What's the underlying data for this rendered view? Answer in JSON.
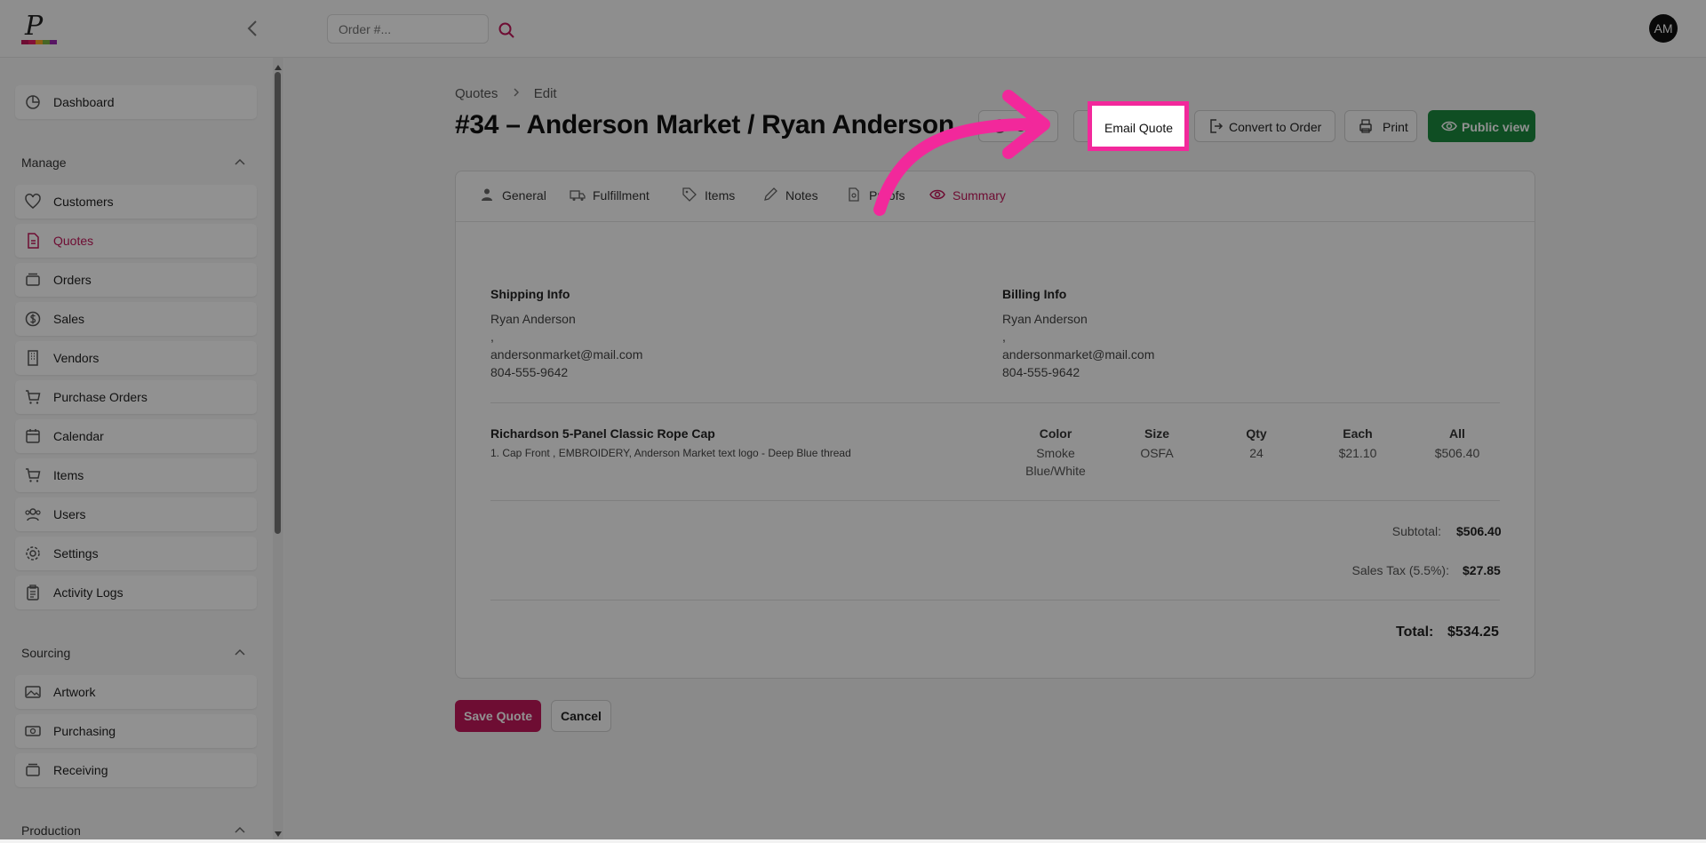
{
  "header": {
    "search": {
      "placeholder": "Order #...",
      "value": ""
    },
    "search_icon": "search-icon",
    "collapse_icon": "chevron-left-icon",
    "avatar_initials": "AM"
  },
  "sidebar": {
    "top_item": {
      "label": "Dashboard",
      "icon": "chart-pie-icon"
    },
    "sections": [
      {
        "title": "Manage",
        "items": [
          {
            "label": "Customers",
            "icon": "heart-icon"
          },
          {
            "label": "Quotes",
            "icon": "document-icon",
            "active": true
          },
          {
            "label": "Orders",
            "icon": "stack-icon"
          },
          {
            "label": "Sales",
            "icon": "dollar-icon"
          },
          {
            "label": "Vendors",
            "icon": "building-icon"
          },
          {
            "label": "Purchase Orders",
            "icon": "cart-icon"
          },
          {
            "label": "Calendar",
            "icon": "calendar-icon"
          },
          {
            "label": "Items",
            "icon": "cart-icon"
          },
          {
            "label": "Users",
            "icon": "users-icon"
          },
          {
            "label": "Settings",
            "icon": "gear-icon"
          },
          {
            "label": "Activity Logs",
            "icon": "clipboard-icon"
          }
        ]
      },
      {
        "title": "Sourcing",
        "items": [
          {
            "label": "Artwork",
            "icon": "image-icon"
          },
          {
            "label": "Purchasing",
            "icon": "money-icon"
          },
          {
            "label": "Receiving",
            "icon": "stack-icon"
          }
        ]
      },
      {
        "title": "Production",
        "items": []
      }
    ]
  },
  "breadcrumb": {
    "parent": "Quotes",
    "current": "Edit"
  },
  "page_title": "#34 – Anderson Market / Ryan Anderson",
  "actions": {
    "save_label": "Save",
    "email_label": "Email Quote",
    "convert_label": "Convert to Order",
    "print_label": "Print",
    "public_label": "Public view"
  },
  "tabs": [
    {
      "label": "General",
      "icon": "user-icon"
    },
    {
      "label": "Fulfillment",
      "icon": "truck-icon"
    },
    {
      "label": "Items",
      "icon": "tag-icon"
    },
    {
      "label": "Notes",
      "icon": "pencil-icon"
    },
    {
      "label": "Proofs",
      "icon": "file-icon"
    },
    {
      "label": "Summary",
      "icon": "eye-icon",
      "active": true
    }
  ],
  "shipping": {
    "title": "Shipping Info",
    "name": "Ryan Anderson",
    "address": ",",
    "email": "andersonmarket@mail.com",
    "phone": "804-555-9642"
  },
  "billing": {
    "title": "Billing Info",
    "name": "Ryan Anderson",
    "address": ",",
    "email": "andersonmarket@mail.com",
    "phone": "804-555-9642"
  },
  "line_item": {
    "name": "Richardson 5-Panel Classic Rope Cap",
    "description": "1. Cap Front , EMBROIDERY, Anderson Market text logo - Deep Blue thread",
    "headers": {
      "color": "Color",
      "size": "Size",
      "qty": "Qty",
      "each": "Each",
      "all": "All"
    },
    "color_line1": "Smoke",
    "color_line2": "Blue/White",
    "size": "OSFA",
    "qty": "24",
    "each": "$21.10",
    "all": "$506.40"
  },
  "totals": {
    "subtotal_label": "Subtotal:",
    "subtotal": "$506.40",
    "tax_label": "Sales Tax (5.5%):",
    "tax": "$27.85",
    "total_label": "Total:",
    "total": "$534.25"
  },
  "footer": {
    "save_quote": "Save Quote",
    "cancel": "Cancel"
  },
  "colors": {
    "accent": "#c2185b",
    "highlight": "#f2289b",
    "green": "#1c8a3f"
  }
}
